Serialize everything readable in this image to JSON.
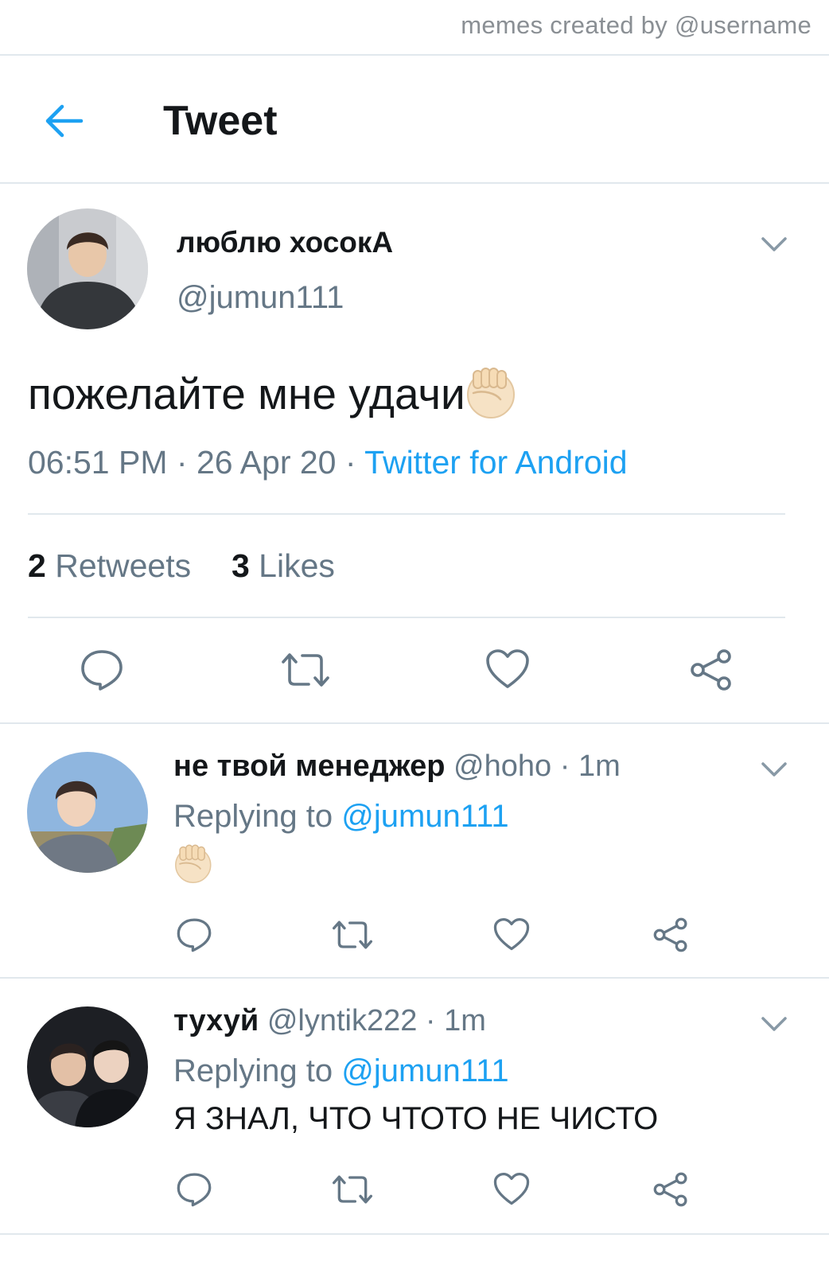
{
  "credit": "memes created by @username",
  "header": {
    "title": "Tweet"
  },
  "tweet": {
    "display_name": "люблю хосокА",
    "handle": "@jumun111",
    "text": "пожелайте мне удачи",
    "emoji": "raised-fist-emoji",
    "time": "06:51 PM",
    "date": "26 Apr 20",
    "client": "Twitter for Android",
    "retweets_count": "2",
    "retweets_label": "Retweets",
    "likes_count": "3",
    "likes_label": "Likes"
  },
  "replies": [
    {
      "display_name": "не твой менеджер",
      "handle": "@hoho",
      "age": "1m",
      "replying_prefix": "Replying to",
      "replying_to": "@jumun111",
      "text": "",
      "emoji": "raised-fist-emoji"
    },
    {
      "display_name": "тухуй",
      "handle": "@lyntik222",
      "age": "1m",
      "replying_prefix": "Replying to",
      "replying_to": "@jumun111",
      "text": "Я ЗНАЛ, ЧТО ЧТОТО НЕ ЧИСТО"
    }
  ],
  "colors": {
    "accent": "#1da1f2",
    "muted": "#657786",
    "divider": "#e1e8ed",
    "icon": "#657786"
  }
}
